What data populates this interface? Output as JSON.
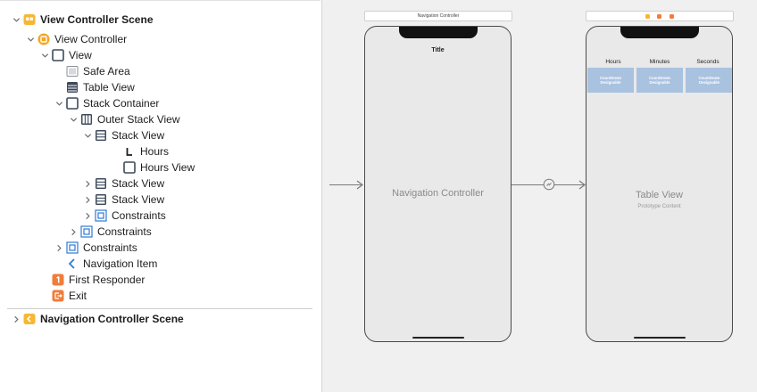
{
  "outline": {
    "items": [
      {
        "label": "View Controller Scene",
        "bold": true,
        "indent": 0,
        "disclosure": "open",
        "icon": "scene-icon"
      },
      {
        "label": "View Controller",
        "bold": false,
        "indent": 1,
        "disclosure": "open",
        "icon": "view-controller-icon"
      },
      {
        "label": "View",
        "bold": false,
        "indent": 2,
        "disclosure": "open",
        "icon": "view-icon"
      },
      {
        "label": "Safe Area",
        "bold": false,
        "indent": 3,
        "disclosure": "none",
        "icon": "safe-area-icon"
      },
      {
        "label": "Table View",
        "bold": false,
        "indent": 3,
        "disclosure": "none",
        "icon": "table-view-icon"
      },
      {
        "label": "Stack Container",
        "bold": false,
        "indent": 3,
        "disclosure": "open",
        "icon": "view-icon"
      },
      {
        "label": "Outer Stack View",
        "bold": false,
        "indent": 4,
        "disclosure": "open",
        "icon": "horizontal-stack-icon"
      },
      {
        "label": "Stack View",
        "bold": false,
        "indent": 5,
        "disclosure": "open",
        "icon": "vertical-stack-icon"
      },
      {
        "label": "Hours",
        "bold": false,
        "indent": 7,
        "disclosure": "none",
        "icon": "label-icon"
      },
      {
        "label": "Hours View",
        "bold": false,
        "indent": 7,
        "disclosure": "none",
        "icon": "view-icon"
      },
      {
        "label": "Stack View",
        "bold": false,
        "indent": 5,
        "disclosure": "closed",
        "icon": "vertical-stack-icon"
      },
      {
        "label": "Stack View",
        "bold": false,
        "indent": 5,
        "disclosure": "closed",
        "icon": "vertical-stack-icon"
      },
      {
        "label": "Constraints",
        "bold": false,
        "indent": 5,
        "disclosure": "closed",
        "icon": "constraints-icon"
      },
      {
        "label": "Constraints",
        "bold": false,
        "indent": 4,
        "disclosure": "closed",
        "icon": "constraints-icon"
      },
      {
        "label": "Constraints",
        "bold": false,
        "indent": 3,
        "disclosure": "closed",
        "icon": "constraints-icon"
      },
      {
        "label": "Navigation Item",
        "bold": false,
        "indent": 3,
        "disclosure": "none",
        "icon": "navigation-item-icon"
      },
      {
        "label": "First Responder",
        "bold": false,
        "indent": 2,
        "disclosure": "none",
        "icon": "first-responder-icon"
      },
      {
        "label": "Exit",
        "bold": false,
        "indent": 2,
        "disclosure": "none",
        "icon": "exit-icon"
      },
      {
        "label": "Navigation Controller Scene",
        "bold": true,
        "indent": 0,
        "disclosure": "closed",
        "icon": "nav-scene-icon"
      }
    ]
  },
  "canvas": {
    "nav_scene_bar": "Navigation Controller",
    "nav_controller_label": "Navigation Controller",
    "nav_title": "Title",
    "table_view_label": "Table View",
    "table_view_sub": "Prototype Content",
    "column_headers": [
      "Hours",
      "Minutes",
      "Seconds"
    ],
    "cell_line1": "CountDown",
    "cell_line2": "Designable",
    "colors": {
      "scene_yellow": "#f7b731",
      "view_controller_orange": "#f5a623",
      "view_icon": "#3d4a5c",
      "constraints_blue": "#2f7ad6",
      "first_responder": "#f07d3a",
      "exit_orange": "#f07d3a",
      "cell_blue": "#a9c2e0"
    }
  }
}
